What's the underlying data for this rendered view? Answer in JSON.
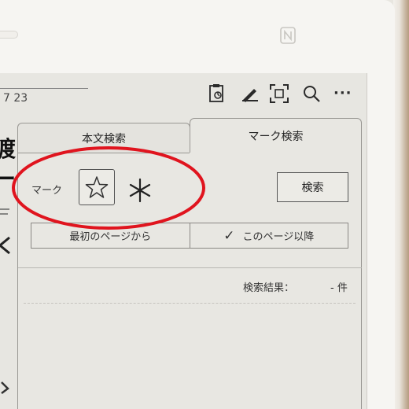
{
  "device": {
    "nfc_icon": "nfc-icon"
  },
  "reader": {
    "page_number": "7 23",
    "book_chars": [
      "渡",
      "ー"
    ]
  },
  "toolbar": {
    "icons": [
      "document-icon",
      "pen-icon",
      "fullscreen-icon",
      "search-icon",
      "more-icon"
    ],
    "more_label": "···"
  },
  "search_panel": {
    "tabs": [
      {
        "label": "本文検索",
        "active": false
      },
      {
        "label": "マーク検索",
        "active": true
      }
    ],
    "mark_label": "マーク",
    "marks": [
      "star-icon",
      "asterisk-icon"
    ],
    "search_button": "検索",
    "range_options": [
      {
        "label": "最初のページから",
        "checked": false
      },
      {
        "label": "このページ以降",
        "checked": true
      }
    ],
    "check_symbol": "✓",
    "result_label": "検索結果：",
    "result_count": "- 件"
  },
  "annotation": {
    "highlight_color": "#e0141e"
  }
}
